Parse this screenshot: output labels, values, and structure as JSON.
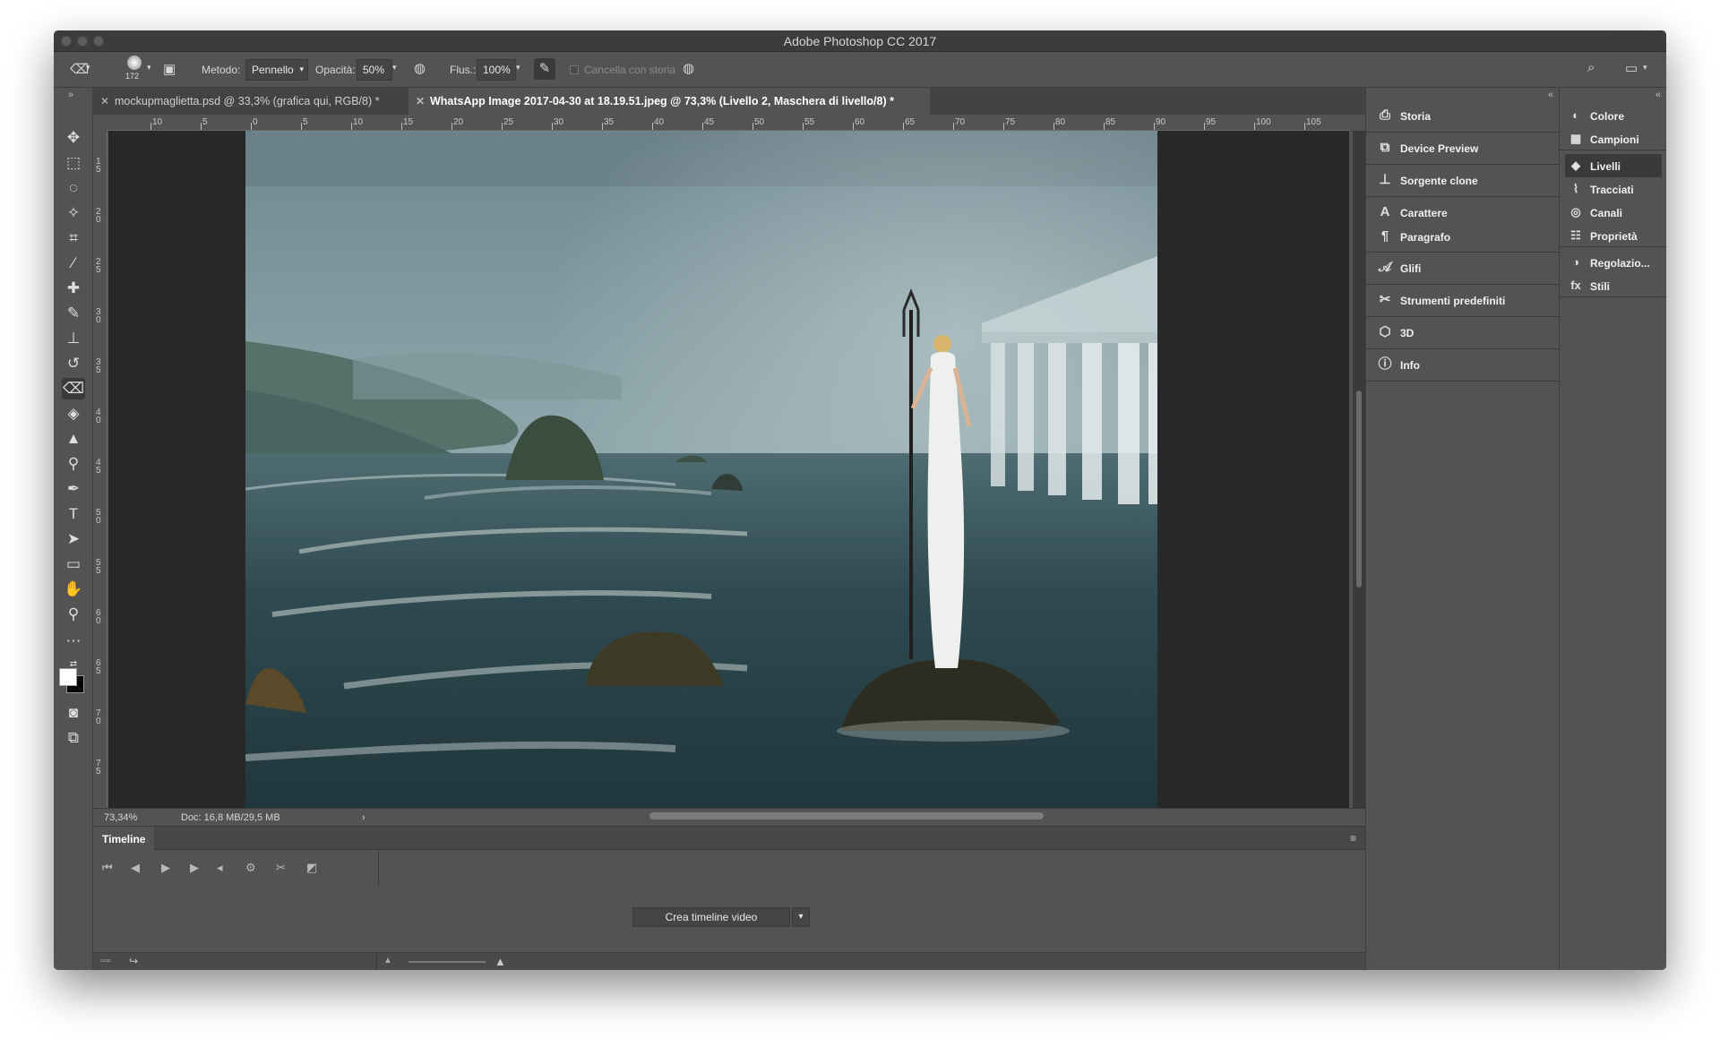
{
  "window": {
    "title": "Adobe Photoshop CC 2017"
  },
  "options": {
    "brush_size": "172",
    "metodo_label": "Metodo:",
    "metodo_value": "Pennello",
    "opacita_label": "Opacità:",
    "opacita_value": "50%",
    "flusso_label": "Flus.:",
    "flusso_value": "100%",
    "cancella_label": "Cancella con storia"
  },
  "tabs": [
    {
      "label": "mockupmaglietta.psd @ 33,3% (grafica qui, RGB/8) *"
    },
    {
      "label": "WhatsApp Image 2017-04-30 at 18.19.51.jpeg @ 73,3% (Livello 2, Maschera di livello/8) *"
    }
  ],
  "ruler_h": [
    "10",
    "5",
    "0",
    "5",
    "10",
    "15",
    "20",
    "25",
    "30",
    "35",
    "40",
    "45",
    "50",
    "55",
    "60",
    "65",
    "70",
    "75",
    "80",
    "85",
    "90",
    "95",
    "100",
    "105"
  ],
  "ruler_v": [
    "1\n5",
    "2\n0",
    "2\n5",
    "3\n0",
    "3\n5",
    "4\n0",
    "4\n5",
    "5\n0",
    "5\n5",
    "6\n0",
    "6\n5",
    "7\n0",
    "7\n5"
  ],
  "status": {
    "zoom": "73,34%",
    "doc": "Doc: 16,8 MB/29,5 MB"
  },
  "timeline": {
    "title": "Timeline",
    "create_button": "Crea timeline video"
  },
  "panels_left": [
    {
      "label": "Storia",
      "icon": "history-icon"
    },
    {
      "label": "Device Preview",
      "icon": "device-preview-icon"
    },
    {
      "label": "Sorgente clone",
      "icon": "clone-source-icon"
    },
    {
      "label": "Carattere",
      "icon": "character-icon"
    },
    {
      "label": "Paragrafo",
      "icon": "paragraph-icon"
    },
    {
      "label": "Glifi",
      "icon": "glyphs-icon"
    },
    {
      "label": "Strumenti predefiniti",
      "icon": "tool-presets-icon"
    },
    {
      "label": "3D",
      "icon": "3d-icon"
    },
    {
      "label": "Info",
      "icon": "info-icon"
    }
  ],
  "panels_right": [
    {
      "label": "Colore",
      "icon": "color-icon"
    },
    {
      "label": "Campioni",
      "icon": "swatches-icon"
    },
    {
      "label": "Livelli",
      "icon": "layers-icon"
    },
    {
      "label": "Tracciati",
      "icon": "paths-icon"
    },
    {
      "label": "Canali",
      "icon": "channels-icon"
    },
    {
      "label": "Proprietà",
      "icon": "properties-icon"
    },
    {
      "label": "Regolazio...",
      "icon": "adjustments-icon"
    },
    {
      "label": "Stili",
      "icon": "styles-icon"
    }
  ],
  "colors": {
    "ui_bg": "#535353",
    "panel_dark": "#434343",
    "sea": "#2f4a50",
    "sky": "#8aa0a6"
  }
}
